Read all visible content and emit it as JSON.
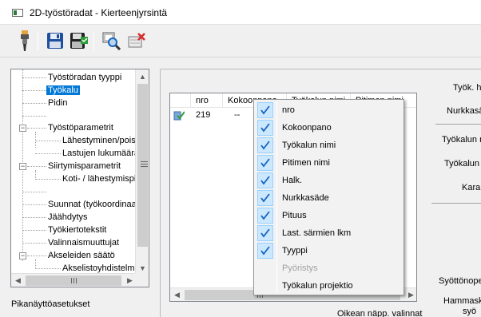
{
  "window": {
    "title": "2D-työstöradat - Kierteenjyrsintä"
  },
  "toolbar": {
    "buttons": [
      {
        "name": "tool-button",
        "icon": "drill-tool-icon"
      },
      {
        "name": "save-button",
        "icon": "floppy-disk-icon"
      },
      {
        "name": "save-as-button",
        "icon": "save-green-icon"
      },
      {
        "name": "preview-button",
        "icon": "magnifier-icon"
      },
      {
        "name": "delete-button",
        "icon": "delete-x-icon"
      }
    ]
  },
  "tree": {
    "items": [
      {
        "label": "Työstöradan tyyppi",
        "level": 1
      },
      {
        "label": "Työkalu",
        "level": 1,
        "selected": true
      },
      {
        "label": "Pidin",
        "level": 1
      },
      {
        "label": "",
        "level": 1
      },
      {
        "label": "Työstöparametrit",
        "level": 0,
        "expanded": true
      },
      {
        "label": "Lähestyminen/poistuminen",
        "level": 2
      },
      {
        "label": "Lastujen lukumäärä",
        "level": 2
      },
      {
        "label": "Siirtymisparametrit",
        "level": 0,
        "expanded": true
      },
      {
        "label": "Koti- / lähestymispiste",
        "level": 2
      },
      {
        "label": "",
        "level": 1
      },
      {
        "label": "Suunnat (työkoordinaatisto)",
        "level": 1
      },
      {
        "label": "Jäähdytys",
        "level": 1
      },
      {
        "label": "Työkiertotekstit",
        "level": 1
      },
      {
        "label": "Valinnaismuuttujat",
        "level": 1
      },
      {
        "label": "Akseleiden säätö",
        "level": 0,
        "expanded": true
      },
      {
        "label": "Akselistoyhdistelmä",
        "level": 2
      }
    ]
  },
  "quick_settings_label": "Pikanäyttöasetukset",
  "list": {
    "columns": [
      "nro",
      "Kokoonpano",
      "Työkalun nimi",
      "Pitimen nimi"
    ],
    "rows": [
      {
        "nro": "219",
        "kokoonpano": "--"
      }
    ]
  },
  "context_menu": {
    "items": [
      {
        "label": "nro",
        "checked": true,
        "enabled": true
      },
      {
        "label": "Kokoonpano",
        "checked": true,
        "enabled": true
      },
      {
        "label": "Työkalun  nimi",
        "checked": true,
        "enabled": true
      },
      {
        "label": "Pitimen nimi",
        "checked": true,
        "enabled": true
      },
      {
        "label": "Halk.",
        "checked": true,
        "enabled": true
      },
      {
        "label": "Nurkkasäde",
        "checked": true,
        "enabled": true
      },
      {
        "label": "Pituus",
        "checked": true,
        "enabled": true
      },
      {
        "label": "Last. särmien lkm",
        "checked": true,
        "enabled": true
      },
      {
        "label": "Tyyppi",
        "checked": true,
        "enabled": true
      },
      {
        "label": "Pyöristys",
        "checked": false,
        "enabled": false
      },
      {
        "label": "Työkalun projektio",
        "checked": false,
        "enabled": true
      }
    ]
  },
  "right_panel": {
    "labels": [
      "Työk. h",
      "Nurkkasä",
      "Työkalun n",
      "Työkalun",
      "Kara",
      "Syöttönope",
      "Hammask",
      "syö"
    ]
  },
  "bottom_hint": "Oikean näpp. valinnat",
  "colors": {
    "selection": "#0078d7",
    "check_bg": "#cce8ff",
    "accent_blue": "#1565c0"
  }
}
